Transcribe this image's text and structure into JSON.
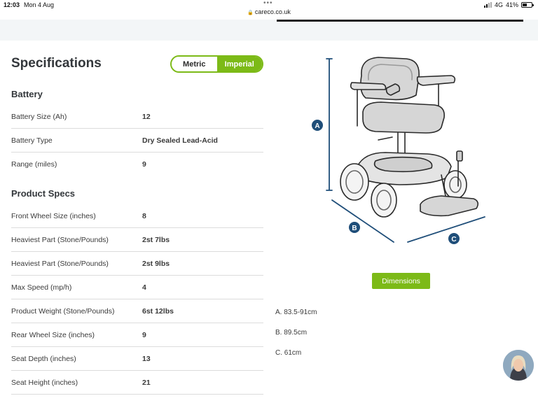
{
  "status_bar": {
    "time": "12:03",
    "date": "Mon 4 Aug",
    "network": "4G",
    "battery": "41%",
    "battery_level": 0.41
  },
  "browser": {
    "url": "careco.co.uk"
  },
  "specs": {
    "title": "Specifications",
    "toggle": {
      "metric": "Metric",
      "imperial": "Imperial",
      "selected": "Imperial"
    },
    "battery_section": {
      "heading": "Battery",
      "rows": [
        {
          "label": "Battery Size (Ah)",
          "value": "12"
        },
        {
          "label": "Battery Type",
          "value": "Dry Sealed Lead-Acid"
        },
        {
          "label": "Range (miles)",
          "value": "9"
        }
      ]
    },
    "product_section": {
      "heading": "Product Specs",
      "rows": [
        {
          "label": "Front Wheel Size (inches)",
          "value": "8"
        },
        {
          "label": "Heaviest Part (Stone/Pounds)",
          "value": "2st 7lbs"
        },
        {
          "label": "Heaviest Part (Stone/Pounds)",
          "value": "2st 9lbs"
        },
        {
          "label": "Max Speed (mp/h)",
          "value": "4"
        },
        {
          "label": "Product Weight (Stone/Pounds)",
          "value": "6st 12lbs"
        },
        {
          "label": "Rear Wheel Size (inches)",
          "value": "9"
        },
        {
          "label": "Seat Depth (inches)",
          "value": "13"
        },
        {
          "label": "Seat Height (inches)",
          "value": "21"
        }
      ]
    }
  },
  "diagram": {
    "markers": {
      "a": "A",
      "b": "B",
      "c": "C"
    },
    "button": "Dimensions",
    "dimensions": [
      "A. 83.5-91cm",
      "B. 89.5cm",
      "C. 61cm"
    ]
  },
  "icons": {
    "lock": "lock-icon",
    "signal": "signal-icon",
    "battery": "battery-icon",
    "chat": "chat-avatar"
  },
  "colors": {
    "accent": "#7cba17",
    "marker": "#1f4e79"
  }
}
